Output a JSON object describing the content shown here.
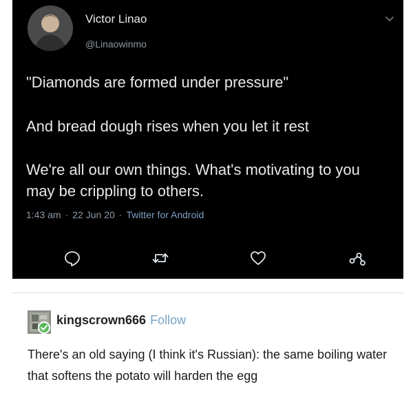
{
  "tweet": {
    "display_name": "Victor Linao",
    "handle": "@Linaowinmo",
    "line1": "\"Diamonds are formed under pressure\"",
    "line2": "And bread dough rises when you let it rest",
    "line3": "We're all our own things. What's motivating to you may be crippling to others.",
    "time": "1:43 am",
    "date": "22 Jun 20",
    "source": "Twitter for Android",
    "separator": "·",
    "icons": [
      "chevron-down-icon",
      "reply-icon",
      "retweet-icon",
      "like-icon",
      "share-icon"
    ]
  },
  "post": {
    "username": "kingscrown666",
    "follow_label": "Follow",
    "text": "There's an old saying (I think it's Russian): the same boiling water that softens the potato will harden the egg",
    "icons": [
      "avatar-icon"
    ]
  }
}
